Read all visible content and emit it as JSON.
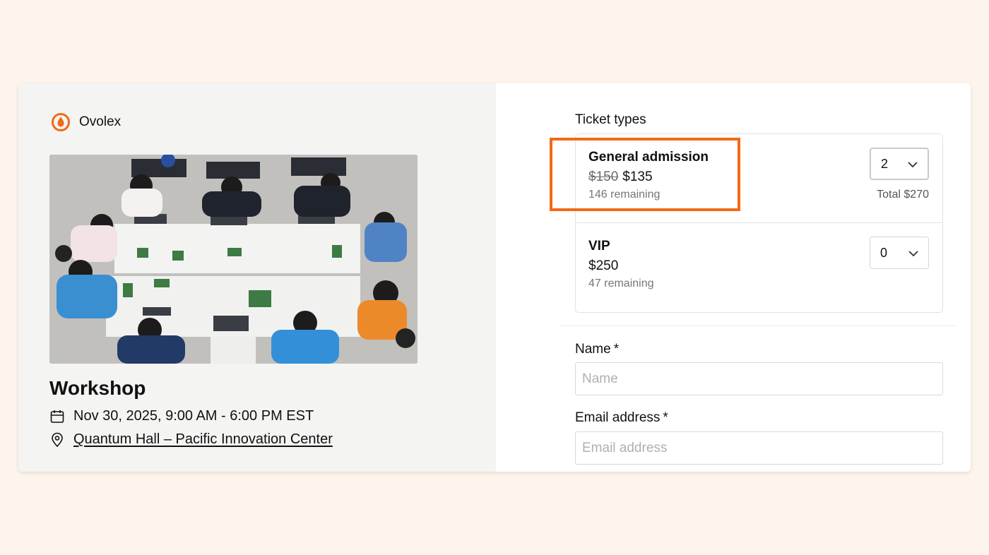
{
  "brand": {
    "name": "Ovolex",
    "logo_icon": "flame-logo-icon",
    "accent_color": "#f26a16"
  },
  "event": {
    "title": "Workshop",
    "datetime": "Nov 30, 2025, 9:00 AM - 6:00 PM EST",
    "location": "Quantum Hall – Pacific Innovation Center",
    "image_icon": "workshop-photo"
  },
  "tickets": {
    "section_label": "Ticket types",
    "items": [
      {
        "name": "General admission",
        "original_price": "$150",
        "price": "$135",
        "remaining": "146 remaining",
        "quantity": "2",
        "total": "Total $270"
      },
      {
        "name": "VIP",
        "price": "$250",
        "remaining": "47 remaining",
        "quantity": "0"
      }
    ]
  },
  "form": {
    "name_label": "Name",
    "name_placeholder": "Name",
    "email_label": "Email address",
    "email_placeholder": "Email address",
    "required_marker": "*"
  },
  "highlight_color": "#f26a16"
}
